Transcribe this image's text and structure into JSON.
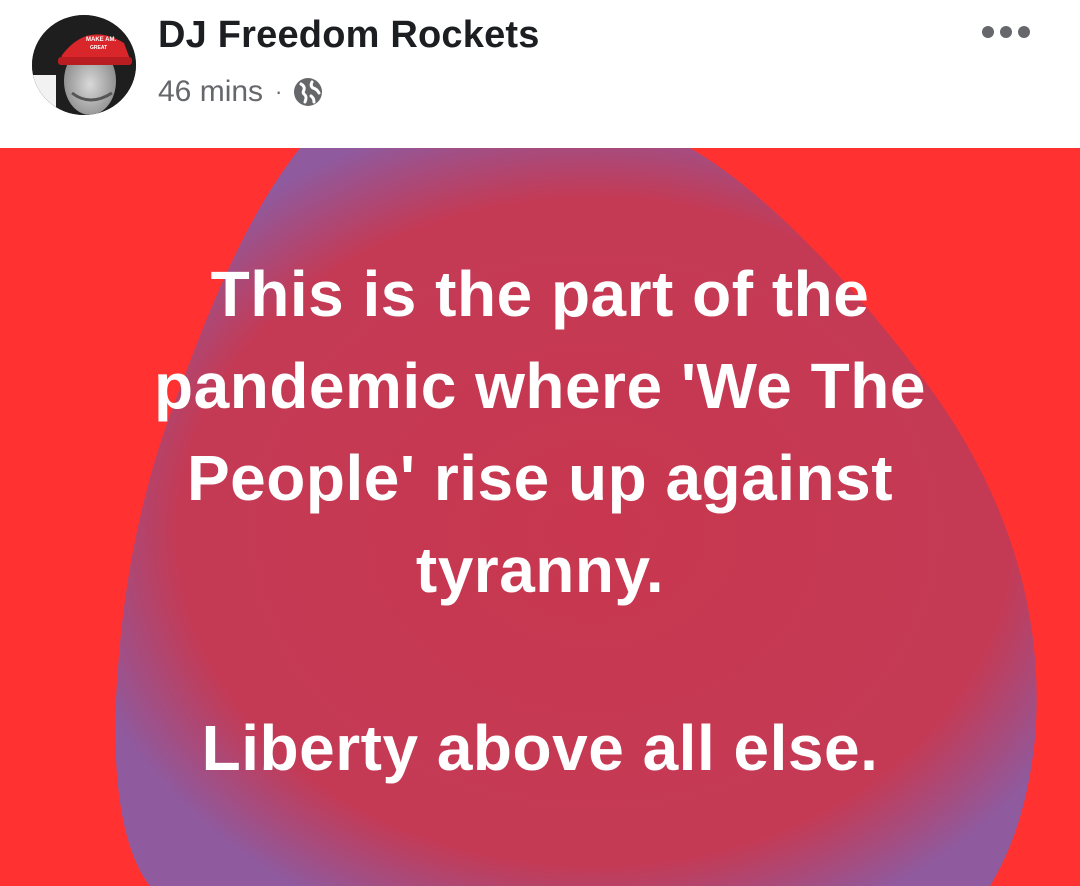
{
  "post": {
    "author_name": "DJ Freedom Rockets",
    "timestamp": "46 mins",
    "separator": "·",
    "privacy_icon": "globe-icon",
    "more_icon": "more-dots-icon",
    "avatar_hat_text": "MAKE AMERICA GREAT AGAIN"
  },
  "card": {
    "background_color": "#ff3131",
    "blob_color": "#c8374f",
    "blob_edge_color": "#8f5a9e",
    "text_color": "#ffffff",
    "lines": [
      "This is the part of the",
      "pandemic where 'We The",
      "People' rise up against",
      "tyranny."
    ],
    "closing_line": "Liberty above all else."
  }
}
